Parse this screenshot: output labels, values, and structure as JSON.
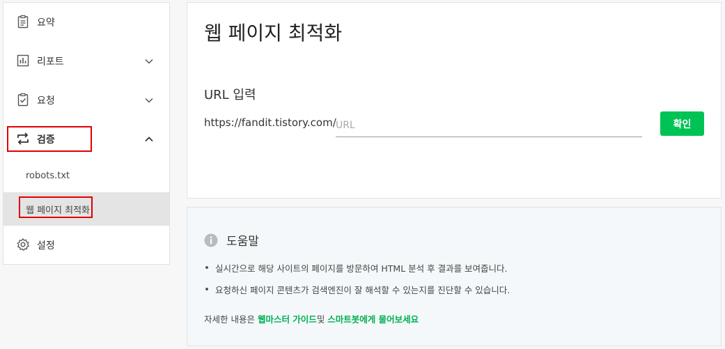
{
  "sidebar": {
    "items": [
      {
        "label": "요약",
        "icon": "clipboard-icon"
      },
      {
        "label": "리포트",
        "icon": "bar-chart-icon"
      },
      {
        "label": "요청",
        "icon": "checklist-icon"
      },
      {
        "label": "검증",
        "icon": "swap-arrows-icon"
      },
      {
        "label": "설정",
        "icon": "gear-icon"
      }
    ],
    "sub_items": [
      {
        "label": "robots.txt"
      },
      {
        "label": "웹 페이지 최적화"
      }
    ]
  },
  "main": {
    "title": "웹 페이지 최적화",
    "url_label": "URL 입력",
    "url_prefix": "https://fandit.tistory.com/",
    "url_placeholder": "URL",
    "url_value": "",
    "confirm_label": "확인"
  },
  "help": {
    "title": "도움말",
    "bullets": [
      "실시간으로 해당 사이트의 페이지를 방문하여 HTML 분석 후 결과를 보여줍니다.",
      "요청하신 페이지 콘텐츠가 검색엔진이 잘 해석할 수 있는지를 진단할 수 있습니다."
    ],
    "footer_prefix": "자세한 내용은 ",
    "link1": "웹마스터 가이드",
    "footer_mid": "및 ",
    "link2": "스마트봇에게 물어보세요"
  },
  "colors": {
    "accent": "#00c355",
    "highlight_box": "#e00000",
    "link": "#00b050"
  }
}
